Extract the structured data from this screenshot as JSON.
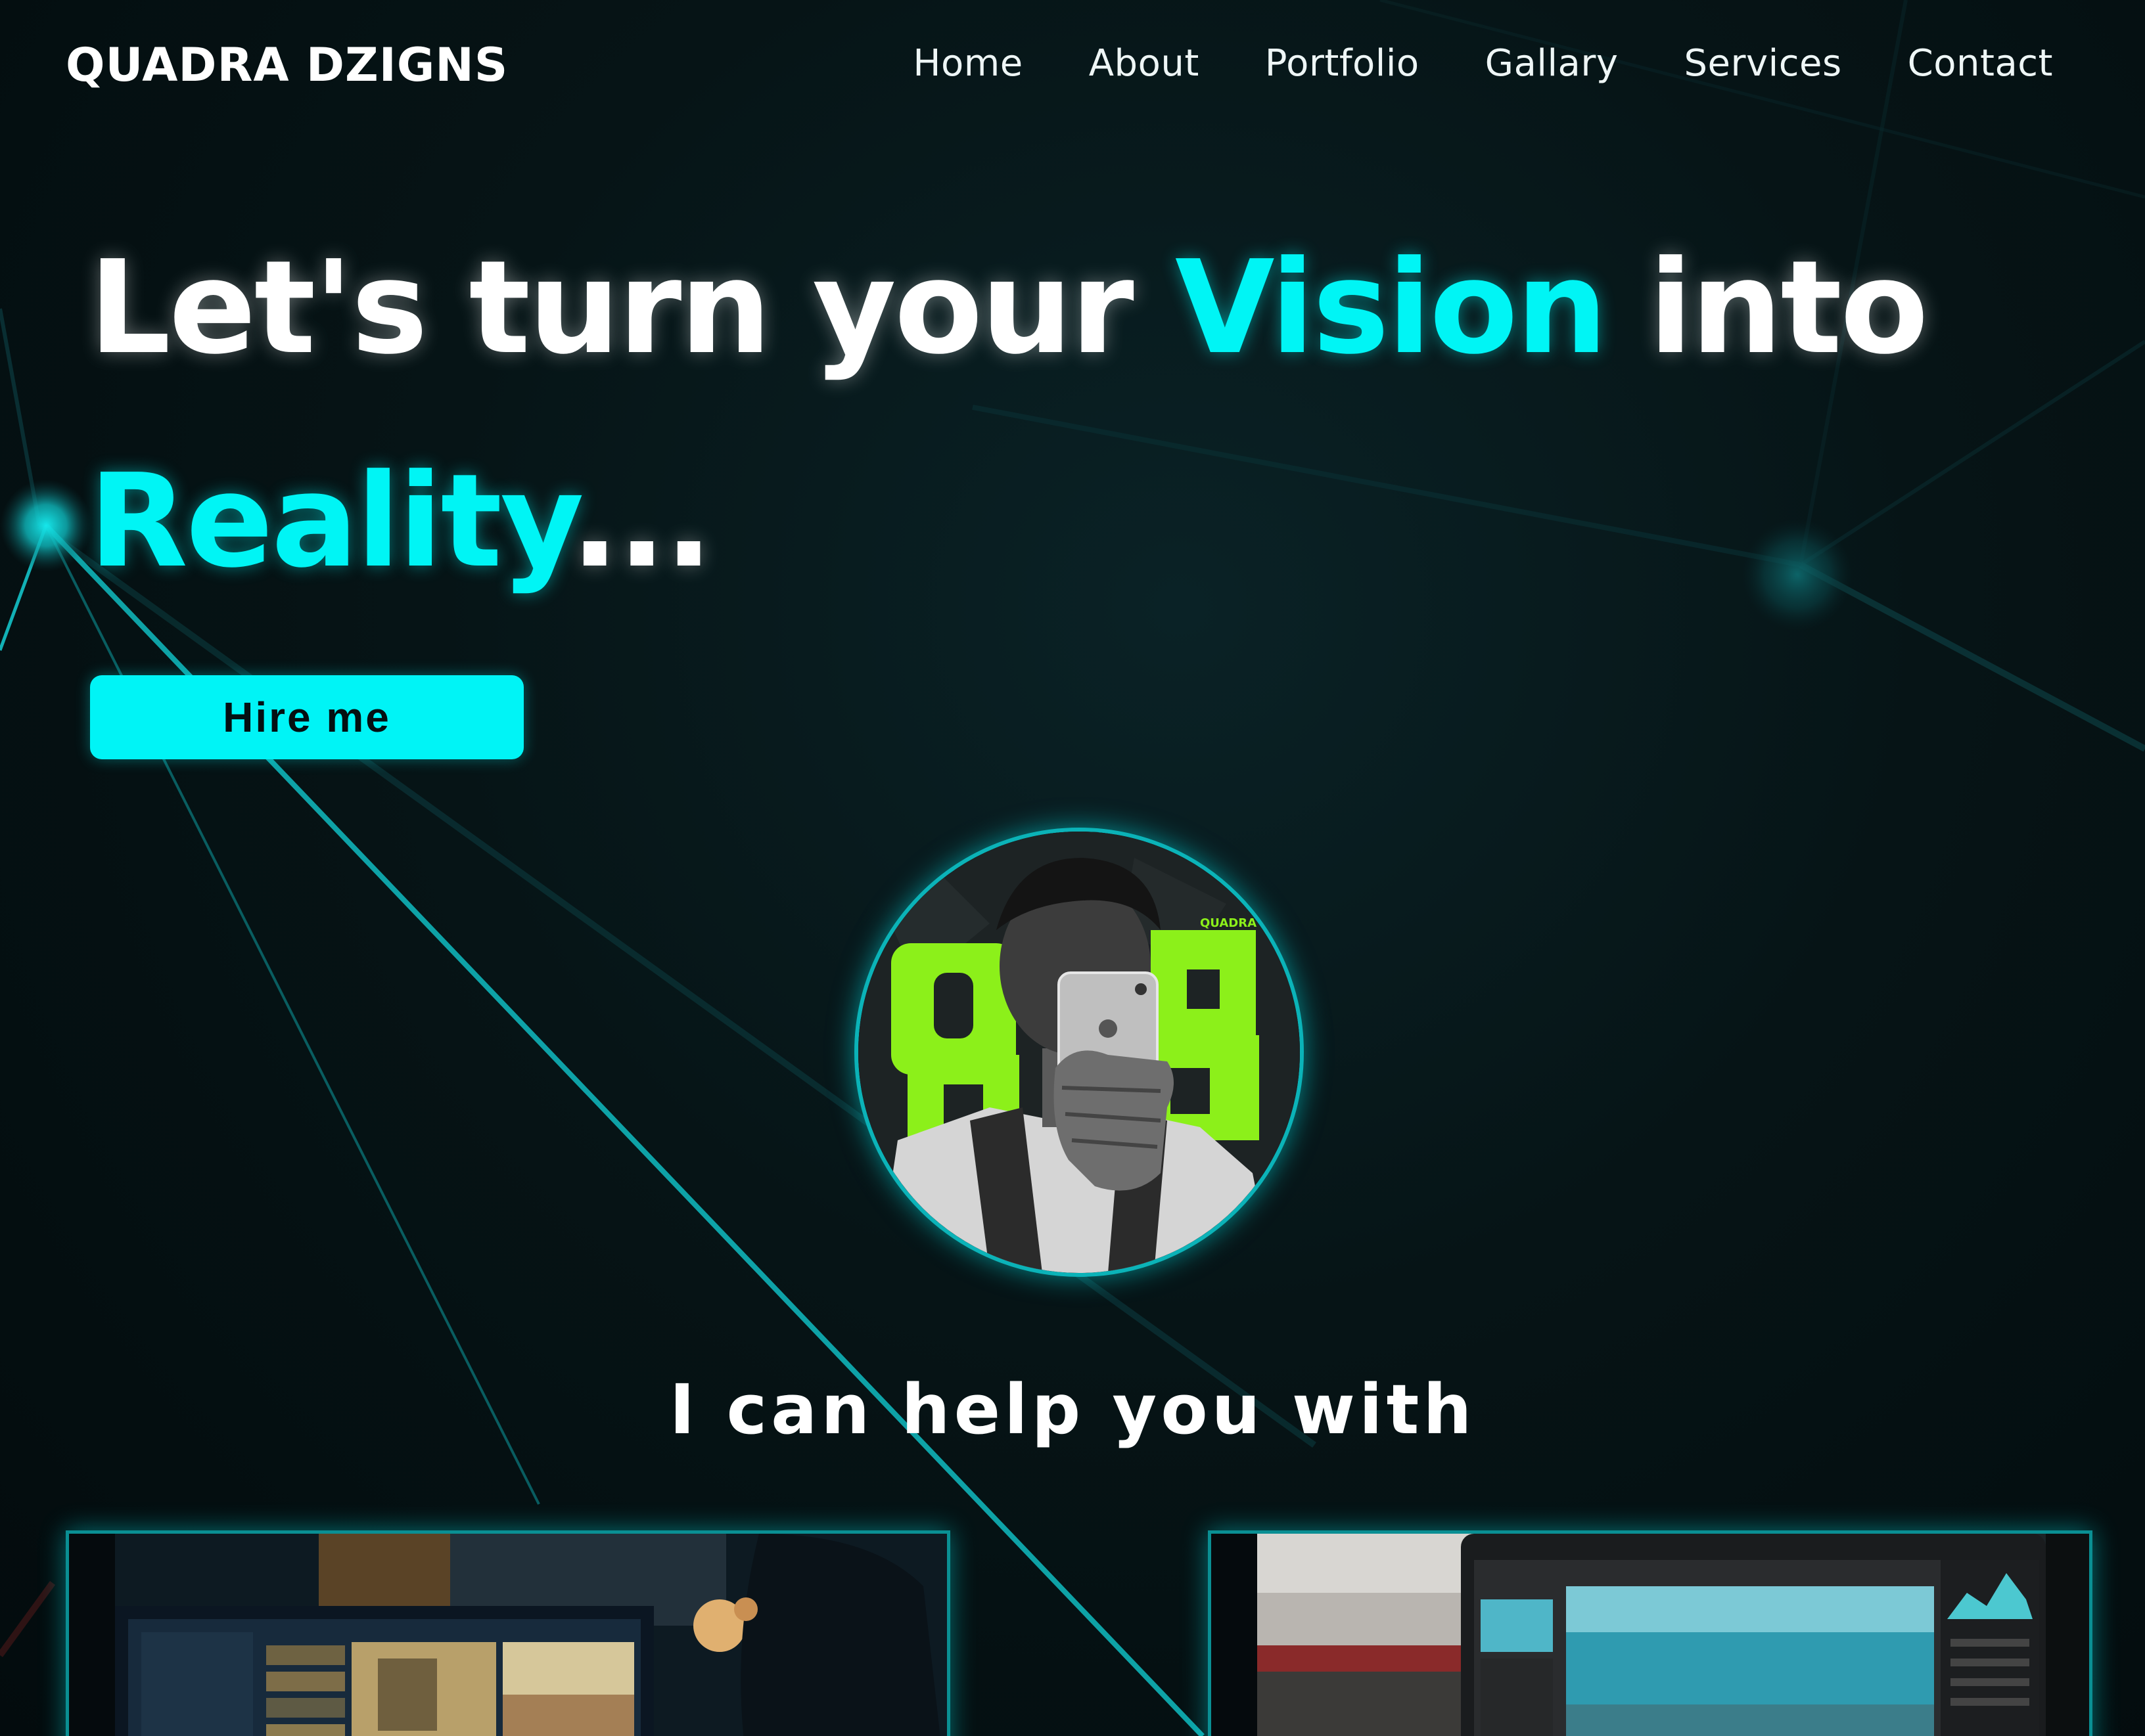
{
  "brand": "QUADRA DZIGNS",
  "nav": {
    "items": [
      "Home",
      "About",
      "Portfolio",
      "Gallary",
      "Services",
      "Contact"
    ]
  },
  "hero": {
    "line1_a": "Let's turn your ",
    "line1_accent": "Vision",
    "line1_b": " into",
    "line2_accent": "Reality",
    "line2_b": "...",
    "cta": "Hire me"
  },
  "avatar": {
    "poster_text": "QUADRA"
  },
  "services": {
    "heading": "I can help you with"
  },
  "colors": {
    "accent": "#00f5f5",
    "background": "#041012",
    "text": "#ffffff",
    "poster_green": "#8cf01a"
  },
  "icons": [
    "avatar-photo",
    "video-editing-photo",
    "photo-editing-photo"
  ]
}
